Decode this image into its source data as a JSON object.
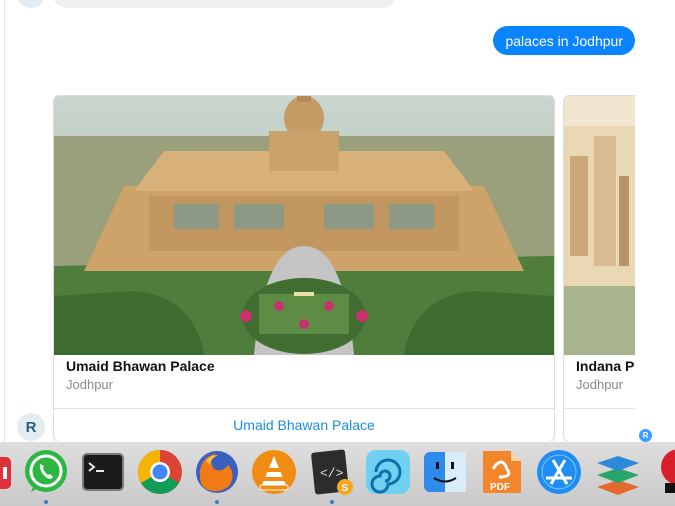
{
  "chat": {
    "avatar_initial": "R",
    "user_query": "palaces in Jodhpur"
  },
  "carousel": {
    "cards": [
      {
        "title": "Umaid Bhawan Palace",
        "subtitle": "Jodhpur",
        "link_label": "Umaid Bhawan Palace"
      },
      {
        "title": "Indana P",
        "subtitle": "Jodhpur",
        "link_label": ""
      }
    ],
    "next_icon": "chevron-right-icon"
  },
  "dock": {
    "apps": [
      {
        "name": "partial-red-app",
        "running": false
      },
      {
        "name": "whatsapp",
        "running": true
      },
      {
        "name": "terminal",
        "running": false
      },
      {
        "name": "chrome",
        "running": false
      },
      {
        "name": "firefox",
        "running": true
      },
      {
        "name": "vlc",
        "running": false
      },
      {
        "name": "script-editor",
        "running": true
      },
      {
        "name": "swirl-app",
        "running": false
      },
      {
        "name": "finder",
        "running": false
      },
      {
        "name": "pdf-app",
        "running": false
      },
      {
        "name": "app-store",
        "running": false
      },
      {
        "name": "layers-app",
        "running": false
      },
      {
        "name": "partial-red-app-right",
        "running": false
      }
    ],
    "badge": "R",
    "pdf_label": "PDF"
  },
  "colors": {
    "accent_blue": "#0b84ff",
    "link_blue": "#1a8fe3",
    "subtitle_gray": "#8a8a8a"
  }
}
